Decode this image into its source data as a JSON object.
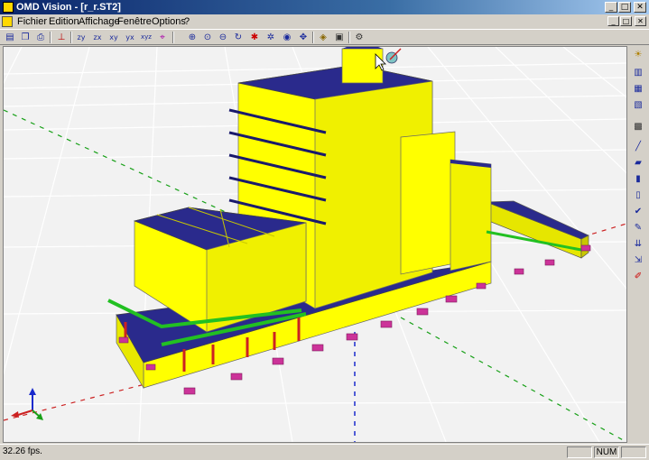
{
  "window": {
    "title": "OMD Vision - [r_r.ST2]",
    "buttons": {
      "minimize": "_",
      "maximize": "□",
      "close": "✕"
    }
  },
  "menu": {
    "items": [
      {
        "label": "Fichier"
      },
      {
        "label": "Edition"
      },
      {
        "label": "Affichage"
      },
      {
        "label": "Fenêtre"
      },
      {
        "label": "Options"
      },
      {
        "label": "?"
      }
    ]
  },
  "toolbar": {
    "buttons": [
      {
        "name": "open-icon",
        "glyph": "▤"
      },
      {
        "name": "copy-icon",
        "glyph": "❐"
      },
      {
        "name": "print-icon",
        "glyph": "⎙"
      },
      {
        "name": "axis-icon",
        "glyph": "⊥"
      },
      {
        "name": "view-zy-icon",
        "glyph": "zy"
      },
      {
        "name": "view-zx-icon",
        "glyph": "zx"
      },
      {
        "name": "view-xy-icon",
        "glyph": "xy"
      },
      {
        "name": "view-yx-icon",
        "glyph": "yx"
      },
      {
        "name": "view-iso-icon",
        "glyph": "xyz"
      },
      {
        "name": "view-persp-icon",
        "glyph": "⌖"
      },
      {
        "name": "zoom-window-icon",
        "glyph": "⊕"
      },
      {
        "name": "zoom-icon",
        "glyph": "⊙"
      },
      {
        "name": "zoom-out-icon",
        "glyph": "⊖"
      },
      {
        "name": "rotate-icon",
        "glyph": "↻"
      },
      {
        "name": "select-icon",
        "glyph": "✱"
      },
      {
        "name": "orbit-icon",
        "glyph": "✲"
      },
      {
        "name": "eye-icon",
        "glyph": "◉"
      },
      {
        "name": "pan-icon",
        "glyph": "✥"
      },
      {
        "name": "render-icon",
        "glyph": "◈"
      },
      {
        "name": "camera-icon",
        "glyph": "▣"
      },
      {
        "name": "settings-icon",
        "glyph": "⚙"
      }
    ]
  },
  "side_toolbar": {
    "buttons": [
      {
        "name": "lamp-icon",
        "glyph": "☀"
      },
      {
        "name": "layers-icon",
        "glyph": "▥"
      },
      {
        "name": "layers-stack-icon",
        "glyph": "▦"
      },
      {
        "name": "section-icon",
        "glyph": "▧"
      },
      {
        "name": "grid-icon",
        "glyph": "▩"
      },
      {
        "name": "beam-icon",
        "glyph": "╱"
      },
      {
        "name": "slab-icon",
        "glyph": "▰"
      },
      {
        "name": "column-icon",
        "glyph": "▮"
      },
      {
        "name": "wall-icon",
        "glyph": "▯"
      },
      {
        "name": "check-icon",
        "glyph": "✔"
      },
      {
        "name": "draw-icon",
        "glyph": "✎"
      },
      {
        "name": "load-icon",
        "glyph": "⇊"
      },
      {
        "name": "move-icon",
        "glyph": "⇲"
      },
      {
        "name": "edit-icon",
        "glyph": "✐"
      }
    ]
  },
  "status": {
    "fps": "32.26 fps.",
    "num": "NUM"
  },
  "colors": {
    "titlebar_start": "#0a246a",
    "wall": "#ffff00",
    "slab": "#2a2a8c",
    "beam_green": "#22c022",
    "support_magenta": "#cc3399",
    "column_red": "#cc2222",
    "viewport_bg": "#f2f2f2"
  }
}
